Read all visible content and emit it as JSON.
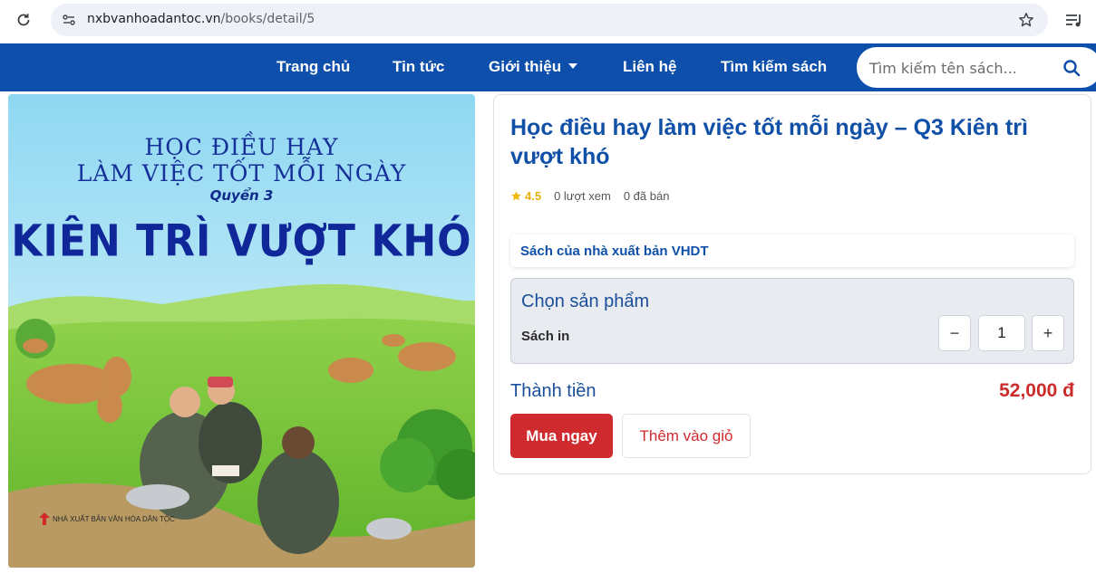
{
  "browser": {
    "url_host": "nxbvanhoadantoc.vn",
    "url_path": "/books/detail/5",
    "icons": {
      "reload": "reload-icon",
      "site_controls": "site-controls-icon",
      "bookmark": "star-icon",
      "media": "media-queue-icon"
    }
  },
  "nav": {
    "items": [
      {
        "label": "Trang chủ"
      },
      {
        "label": "Tin tức"
      },
      {
        "label": "Giới thiệu"
      },
      {
        "label": "Liên hệ"
      },
      {
        "label": "Tìm kiếm sách"
      }
    ],
    "search_placeholder": "Tìm kiếm tên sách...",
    "brand_color": "#0d4fab"
  },
  "cover": {
    "line1": "HỌC ĐIỀU HAY",
    "line2": "LÀM VIỆC TỐT MỖI NGÀY",
    "volume": "Quyển 3",
    "headline": "KIÊN TRÌ VƯỢT KHÓ",
    "publisher": "NHÀ XUẤT BẢN VĂN HÓA DÂN TỘC"
  },
  "product": {
    "title": "Học điều hay làm việc tốt mỗi ngày – Q3 Kiên trì vượt khó",
    "rating": "4.5",
    "views": "0 lượt xem",
    "sold": "0 đã bán",
    "publisher_note": "Sách của nhà xuất bản VHDT",
    "choose_title": "Chọn sản phẩm",
    "variant": "Sách in",
    "quantity": "1",
    "minus": "−",
    "plus": "+",
    "total_label": "Thành tiền",
    "total_value": "52,000 đ",
    "buy_label": "Mua ngay",
    "add_cart_label": "Thêm vào giỏ",
    "accent_red": "#cf2b2f"
  }
}
